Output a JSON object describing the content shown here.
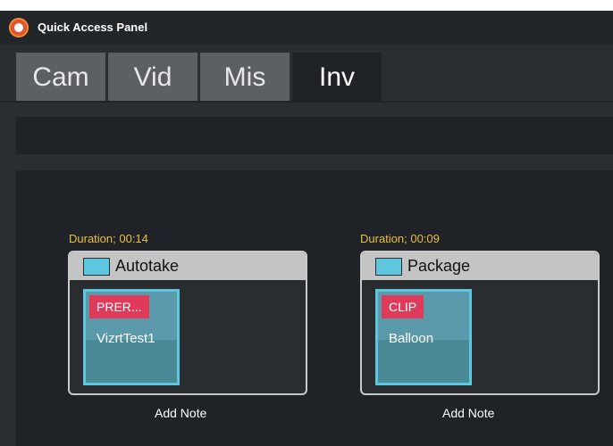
{
  "window": {
    "title": "Quick Access Panel"
  },
  "tabs": [
    {
      "label": "Cam"
    },
    {
      "label": "Vid"
    },
    {
      "label": "Mis"
    },
    {
      "label": "Inv",
      "active": true
    }
  ],
  "items": [
    {
      "duration": "Duration; 00:14",
      "label": "Autotake",
      "badge": "PRER...",
      "name": "VizrtTest1",
      "add_note": "Add Note"
    },
    {
      "duration": "Duration; 00:09",
      "label": "Package",
      "badge": "CLIP",
      "name": "Balloon",
      "add_note": "Add Note"
    }
  ],
  "colors": {
    "duration": "#e8c040",
    "badge": "#e03a5a",
    "tile_border": "#5fc6e0",
    "tile_bg": "#4a8a97"
  }
}
